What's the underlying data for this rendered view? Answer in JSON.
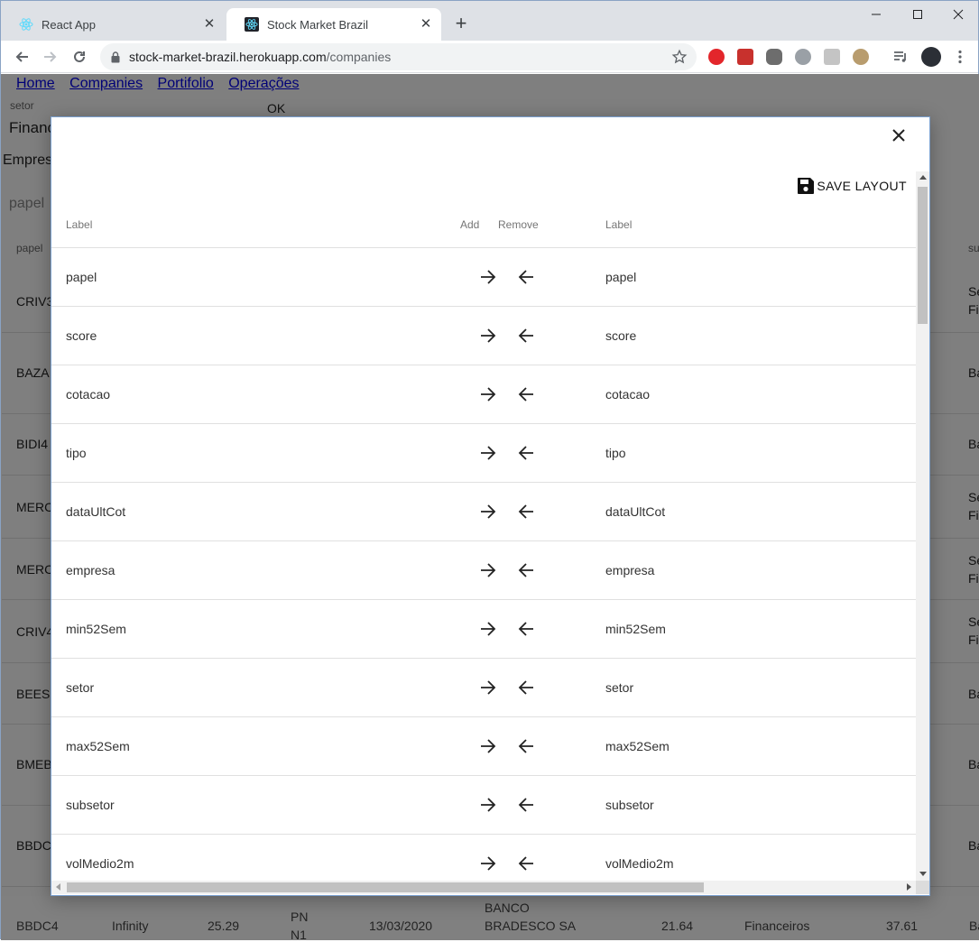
{
  "browser": {
    "tabs": [
      {
        "title": "React App",
        "active": false
      },
      {
        "title": "Stock Market Brazil",
        "active": true
      }
    ],
    "url_host": "stock-market-brazil.herokuapp.com",
    "url_path": "/companies"
  },
  "page": {
    "nav": [
      "Home",
      "Companies",
      "Portifolio",
      "Operações"
    ],
    "setor_label": "setor",
    "setor_value": "Financ",
    "ok_label": "OK",
    "empresas_label": "Empresa",
    "papel_filter_placeholder": "papel",
    "table_header_left": "papel",
    "table_header_right": "su",
    "rows_left": [
      "CRIV3",
      "BAZA",
      "BIDI4",
      "MERC",
      "MERC",
      "CRIV4",
      "BEES",
      "BMEB",
      "BBDC"
    ],
    "rows_right": [
      [
        "Se",
        "Fi"
      ],
      [
        "Ba",
        ""
      ],
      [
        "Ba",
        ""
      ],
      [
        "Se",
        "Fi"
      ],
      [
        "Se",
        "Fi"
      ],
      [
        "Se",
        "Fi"
      ],
      [
        "Ba",
        ""
      ],
      [
        "Ba",
        ""
      ],
      [
        "Ba",
        ""
      ]
    ],
    "last_row": {
      "papel": "BBDC4",
      "tipo_mercado": "Infinity",
      "cotacao": "25.29",
      "tipo_line1": "PN",
      "tipo_line2": "N1",
      "data": "13/03/2020",
      "empresa_line1": "BANCO",
      "empresa_line2": "BRADESCO SA",
      "min": "21.64",
      "setor": "Financeiros",
      "max": "37.61",
      "sub": "Ba"
    }
  },
  "modal": {
    "save_label": "SAVE LAYOUT",
    "columns": {
      "label_left": "Label",
      "add": "Add",
      "remove": "Remove",
      "label_right": "Label"
    },
    "rows": [
      {
        "left": "papel",
        "right": "papel"
      },
      {
        "left": "score",
        "right": "score"
      },
      {
        "left": "cotacao",
        "right": "cotacao"
      },
      {
        "left": "tipo",
        "right": "tipo"
      },
      {
        "left": "dataUltCot",
        "right": "dataUltCot"
      },
      {
        "left": "empresa",
        "right": "empresa"
      },
      {
        "left": "min52Sem",
        "right": "min52Sem"
      },
      {
        "left": "setor",
        "right": "setor"
      },
      {
        "left": "max52Sem",
        "right": "max52Sem"
      },
      {
        "left": "subsetor",
        "right": "subsetor"
      },
      {
        "left": "volMedio2m",
        "right": "volMedio2m"
      }
    ],
    "icons": {
      "add": "arrow-right-icon",
      "remove": "arrow-left-icon",
      "save": "floppy-disk-icon",
      "close": "close-icon"
    }
  }
}
